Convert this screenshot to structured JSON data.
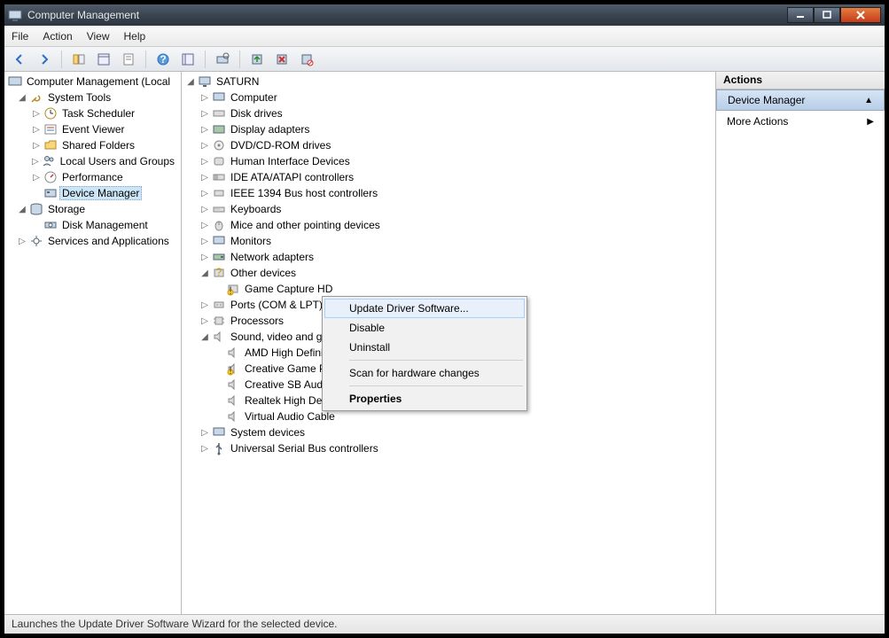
{
  "window": {
    "title": "Computer Management"
  },
  "menu": {
    "file": "File",
    "action": "Action",
    "view": "View",
    "help": "Help"
  },
  "left_tree": {
    "root": "Computer Management (Local",
    "system_tools": "System Tools",
    "task_scheduler": "Task Scheduler",
    "event_viewer": "Event Viewer",
    "shared_folders": "Shared Folders",
    "local_users": "Local Users and Groups",
    "performance": "Performance",
    "device_manager": "Device Manager",
    "storage": "Storage",
    "disk_management": "Disk Management",
    "services_apps": "Services and Applications"
  },
  "device_tree": {
    "root": "SATURN",
    "computer": "Computer",
    "disk_drives": "Disk drives",
    "display_adapters": "Display adapters",
    "dvd": "DVD/CD-ROM drives",
    "hid": "Human Interface Devices",
    "ide": "IDE ATA/ATAPI controllers",
    "ieee1394": "IEEE 1394 Bus host controllers",
    "keyboards": "Keyboards",
    "mice": "Mice and other pointing devices",
    "monitors": "Monitors",
    "network": "Network adapters",
    "other": "Other devices",
    "game_capture": "Game Capture HD",
    "ports": "Ports (COM & LPT)",
    "processors": "Processors",
    "sound": "Sound, video and game controllers",
    "amd_hd": "AMD High Definition Audio Device",
    "creative_game": "Creative Game Port",
    "creative_sb": "Creative SB Audigy",
    "realtek": "Realtek High Definition Audio",
    "virtual_audio": "Virtual Audio Cable",
    "system_devices": "System devices",
    "usb": "Universal Serial Bus controllers"
  },
  "context_menu": {
    "update": "Update Driver Software...",
    "disable": "Disable",
    "uninstall": "Uninstall",
    "scan": "Scan for hardware changes",
    "properties": "Properties"
  },
  "actions": {
    "header": "Actions",
    "device_manager": "Device Manager",
    "more_actions": "More Actions"
  },
  "statusbar": "Launches the Update Driver Software Wizard for the selected device."
}
